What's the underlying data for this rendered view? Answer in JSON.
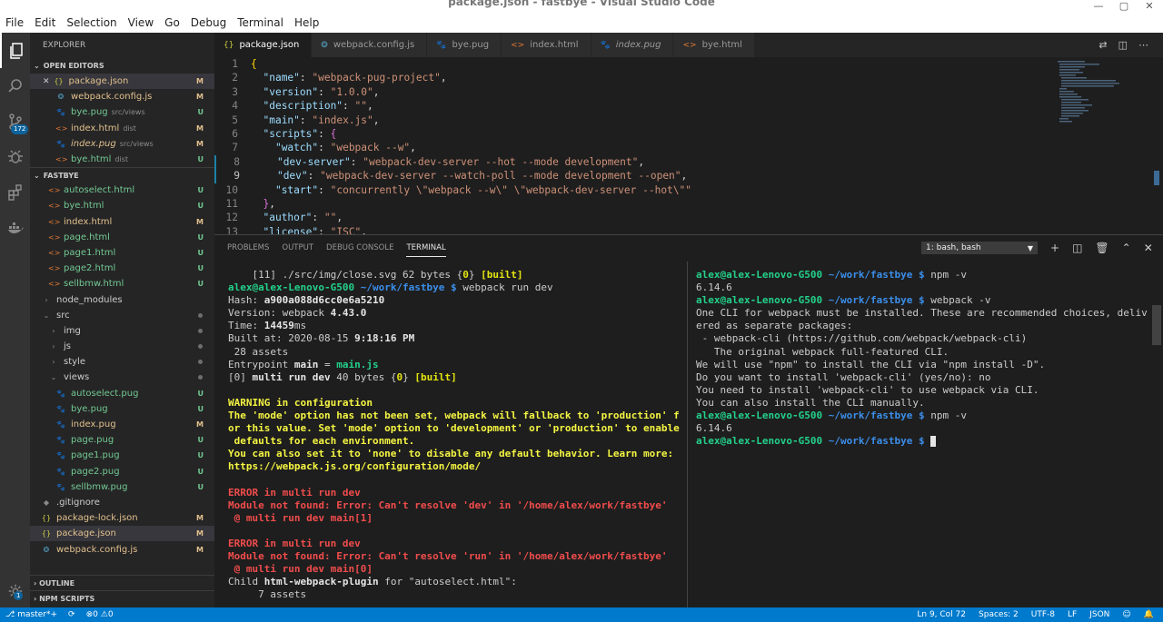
{
  "window": {
    "title": "package.json - fastbye - Visual Studio Code"
  },
  "menu": [
    "File",
    "Edit",
    "Selection",
    "View",
    "Go",
    "Debug",
    "Terminal",
    "Help"
  ],
  "activity": {
    "scm_badge": "172",
    "settings_badge": "1"
  },
  "sidebar": {
    "title": "EXPLORER",
    "open_editors_label": "OPEN EDITORS",
    "open_editors": [
      {
        "name": "package.json",
        "desc": "",
        "status": "M",
        "icon": "json-icon"
      },
      {
        "name": "webpack.config.js",
        "desc": "",
        "status": "M",
        "icon": "webpack-icon"
      },
      {
        "name": "bye.pug",
        "desc": "src/views",
        "status": "U",
        "icon": "pug-icon"
      },
      {
        "name": "index.html",
        "desc": "dist",
        "status": "M",
        "icon": "html-icon"
      },
      {
        "name": "index.pug",
        "desc": "src/views",
        "status": "M",
        "icon": "pug-icon"
      },
      {
        "name": "bye.html",
        "desc": "dist",
        "status": "U",
        "icon": "html-icon"
      }
    ],
    "project_label": "FASTBYE",
    "files": [
      {
        "name": "autoselect.html",
        "status": "U",
        "icon": "html-icon",
        "indent": 1
      },
      {
        "name": "bye.html",
        "status": "U",
        "icon": "html-icon",
        "indent": 1
      },
      {
        "name": "index.html",
        "status": "M",
        "icon": "html-icon",
        "indent": 1
      },
      {
        "name": "page.html",
        "status": "U",
        "icon": "html-icon",
        "indent": 1
      },
      {
        "name": "page1.html",
        "status": "U",
        "icon": "html-icon",
        "indent": 1
      },
      {
        "name": "page2.html",
        "status": "U",
        "icon": "html-icon",
        "indent": 1
      },
      {
        "name": "sellbmw.html",
        "status": "U",
        "icon": "html-icon",
        "indent": 1
      },
      {
        "name": "node_modules",
        "status": "",
        "icon": "folder-closed-icon",
        "indent": 0
      },
      {
        "name": "src",
        "status": "dot",
        "icon": "folder-open-icon",
        "indent": 0
      },
      {
        "name": "img",
        "status": "dot",
        "icon": "folder-closed-icon",
        "indent": 1
      },
      {
        "name": "js",
        "status": "dot",
        "icon": "folder-closed-icon",
        "indent": 1
      },
      {
        "name": "style",
        "status": "dot",
        "icon": "folder-closed-icon",
        "indent": 1
      },
      {
        "name": "views",
        "status": "dot",
        "icon": "folder-open-icon",
        "indent": 1
      },
      {
        "name": "autoselect.pug",
        "status": "U",
        "icon": "pug-icon",
        "indent": 2
      },
      {
        "name": "bye.pug",
        "status": "U",
        "icon": "pug-icon",
        "indent": 2
      },
      {
        "name": "index.pug",
        "status": "M",
        "icon": "pug-icon",
        "indent": 2
      },
      {
        "name": "page.pug",
        "status": "U",
        "icon": "pug-icon",
        "indent": 2
      },
      {
        "name": "page1.pug",
        "status": "U",
        "icon": "pug-icon",
        "indent": 2
      },
      {
        "name": "page2.pug",
        "status": "U",
        "icon": "pug-icon",
        "indent": 2
      },
      {
        "name": "sellbmw.pug",
        "status": "U",
        "icon": "pug-icon",
        "indent": 2
      },
      {
        "name": ".gitignore",
        "status": "",
        "icon": "git-icon",
        "indent": 0
      },
      {
        "name": "package-lock.json",
        "status": "M",
        "icon": "json-icon",
        "indent": 0
      },
      {
        "name": "package.json",
        "status": "M",
        "icon": "json-icon",
        "indent": 0
      },
      {
        "name": "webpack.config.js",
        "status": "M",
        "icon": "webpack-icon",
        "indent": 0
      }
    ],
    "outline_label": "OUTLINE",
    "npm_label": "NPM SCRIPTS"
  },
  "tabs": [
    {
      "label": "package.json",
      "icon": "json-icon",
      "active": true,
      "italic": false
    },
    {
      "label": "webpack.config.js",
      "icon": "webpack-icon",
      "active": false,
      "italic": false
    },
    {
      "label": "bye.pug",
      "icon": "pug-icon",
      "active": false,
      "italic": false
    },
    {
      "label": "index.html",
      "icon": "html-icon",
      "active": false,
      "italic": false
    },
    {
      "label": "index.pug",
      "icon": "pug-icon",
      "active": false,
      "italic": true
    },
    {
      "label": "bye.html",
      "icon": "html-icon",
      "active": false,
      "italic": false
    }
  ],
  "editor": {
    "lines": [
      {
        "n": "1",
        "code": "{"
      },
      {
        "n": "2",
        "code": "  \"name\": \"webpack-pug-project\","
      },
      {
        "n": "3",
        "code": "  \"version\": \"1.0.0\","
      },
      {
        "n": "4",
        "code": "  \"description\": \"\","
      },
      {
        "n": "5",
        "code": "  \"main\": \"index.js\","
      },
      {
        "n": "6",
        "code": "  \"scripts\": {"
      },
      {
        "n": "7",
        "code": "    \"watch\": \"webpack --w\","
      },
      {
        "n": "8",
        "code": "    \"dev-server\": \"webpack-dev-server --hot --mode development\","
      },
      {
        "n": "9",
        "code": "    \"dev\": \"webpack-dev-server --watch-poll --mode development --open\","
      },
      {
        "n": "10",
        "code": "    \"start\": \"concurrently \\\"webpack --w\\\" \\\"webpack-dev-server --hot\\\"\""
      },
      {
        "n": "11",
        "code": "  },"
      },
      {
        "n": "12",
        "code": "  \"author\": \"\","
      },
      {
        "n": "13",
        "code": "  \"license\": \"ISC\","
      }
    ]
  },
  "panel": {
    "tabs": [
      "PROBLEMS",
      "OUTPUT",
      "DEBUG CONSOLE",
      "TERMINAL"
    ],
    "active_tab": "TERMINAL",
    "terminal_select": "1: bash, bash"
  },
  "terminal_left": [
    [
      {
        "t": "    [11] ./src/img/close.svg 62 bytes {"
      },
      {
        "t": "0",
        "c": "y"
      },
      {
        "t": "} "
      },
      {
        "t": "[built]",
        "c": "y"
      }
    ],
    [
      {
        "t": "alex@alex-Lenovo-G500",
        "c": "g"
      },
      {
        "t": " ~/work/fastbye $",
        "c": "b"
      },
      {
        "t": " webpack run dev"
      }
    ],
    [
      {
        "t": "Hash: "
      },
      {
        "t": "a900a088d6cc0e6a5210",
        "c": "w"
      }
    ],
    [
      {
        "t": "Version: webpack "
      },
      {
        "t": "4.43.0",
        "c": "w"
      }
    ],
    [
      {
        "t": "Time: "
      },
      {
        "t": "14459",
        "c": "w"
      },
      {
        "t": "ms"
      }
    ],
    [
      {
        "t": "Built at: 2020-08-15 "
      },
      {
        "t": "9:18:16 PM",
        "c": "w"
      }
    ],
    [
      {
        "t": " 28 assets"
      }
    ],
    [
      {
        "t": "Entrypoint "
      },
      {
        "t": "main",
        "c": "w"
      },
      {
        "t": " = "
      },
      {
        "t": "main.js",
        "c": "g"
      }
    ],
    [
      {
        "t": "[0] "
      },
      {
        "t": "multi run dev",
        "c": "w"
      },
      {
        "t": " 40 bytes {"
      },
      {
        "t": "0",
        "c": "y"
      },
      {
        "t": "} "
      },
      {
        "t": "[built]",
        "c": "y"
      }
    ],
    [
      {
        "t": ""
      }
    ],
    [
      {
        "t": "WARNING in configuration",
        "c": "yl"
      }
    ],
    [
      {
        "t": "The 'mode' option has not been set, webpack will fallback to 'production' f",
        "c": "yl"
      }
    ],
    [
      {
        "t": "or this value. Set 'mode' option to 'development' or 'production' to enable",
        "c": "yl"
      }
    ],
    [
      {
        "t": " defaults for each environment.",
        "c": "yl"
      }
    ],
    [
      {
        "t": "You can also set it to 'none' to disable any default behavior. Learn more:",
        "c": "yl"
      }
    ],
    [
      {
        "t": "https://webpack.js.org/configuration/mode/",
        "c": "yl"
      }
    ],
    [
      {
        "t": ""
      }
    ],
    [
      {
        "t": "ERROR in multi run dev",
        "c": "r"
      }
    ],
    [
      {
        "t": "Module not found: Error: Can't resolve 'dev' in '/home/alex/work/fastbye'",
        "c": "r"
      }
    ],
    [
      {
        "t": " @ multi run dev main[1]",
        "c": "r"
      }
    ],
    [
      {
        "t": ""
      }
    ],
    [
      {
        "t": "ERROR in multi run dev",
        "c": "r"
      }
    ],
    [
      {
        "t": "Module not found: Error: Can't resolve 'run' in '/home/alex/work/fastbye'",
        "c": "r"
      }
    ],
    [
      {
        "t": " @ multi run dev main[0]",
        "c": "r"
      }
    ],
    [
      {
        "t": "Child "
      },
      {
        "t": "html-webpack-plugin",
        "c": "w"
      },
      {
        "t": " for \"autoselect.html\":"
      }
    ],
    [
      {
        "t": "     7 assets"
      }
    ]
  ],
  "terminal_right": [
    [
      {
        "t": "alex@alex-Lenovo-G500",
        "c": "g"
      },
      {
        "t": " ~/work/fastbye $",
        "c": "b"
      },
      {
        "t": " npm -v"
      }
    ],
    [
      {
        "t": "6.14.6"
      }
    ],
    [
      {
        "t": "alex@alex-Lenovo-G500",
        "c": "g"
      },
      {
        "t": " ~/work/fastbye $",
        "c": "b"
      },
      {
        "t": " webpack -v"
      }
    ],
    [
      {
        "t": "One CLI for webpack must be installed. These are recommended choices, deliv"
      }
    ],
    [
      {
        "t": "ered as separate packages:"
      }
    ],
    [
      {
        "t": " - webpack-cli (https://github.com/webpack/webpack-cli)"
      }
    ],
    [
      {
        "t": "   The original webpack full-featured CLI."
      }
    ],
    [
      {
        "t": "We will use \"npm\" to install the CLI via \"npm install -D\"."
      }
    ],
    [
      {
        "t": "Do you want to install 'webpack-cli' (yes/no): no"
      }
    ],
    [
      {
        "t": "You need to install 'webpack-cli' to use webpack via CLI."
      }
    ],
    [
      {
        "t": "You can also install the CLI manually."
      }
    ],
    [
      {
        "t": "alex@alex-Lenovo-G500",
        "c": "g"
      },
      {
        "t": " ~/work/fastbye $",
        "c": "b"
      },
      {
        "t": " npm -v"
      }
    ],
    [
      {
        "t": "6.14.6"
      }
    ],
    [
      {
        "t": "alex@alex-Lenovo-G500",
        "c": "g"
      },
      {
        "t": " ~/work/fastbye $",
        "c": "b"
      },
      {
        "t": " "
      },
      {
        "t": "",
        "c": "cursor"
      }
    ]
  ],
  "status": {
    "branch": "master*+",
    "errors": "0",
    "warnings": "0",
    "position": "Ln 9, Col 72",
    "spaces": "Spaces: 2",
    "encoding": "UTF-8",
    "eol": "LF",
    "language": "JSON"
  }
}
